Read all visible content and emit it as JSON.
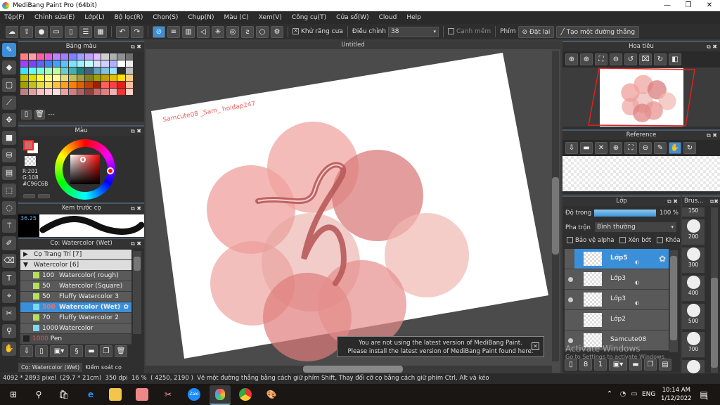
{
  "window": {
    "title": "MediBang Paint Pro (64bit)",
    "minimize": "—",
    "maximize": "❐",
    "close": "✕"
  },
  "menu": [
    "Tệp(F)",
    "Chỉnh sửa(E)",
    "Lớp(L)",
    "Bộ lọc(R)",
    "Chọn(S)",
    "Chụp(N)",
    "Màu (C)",
    "Xem(V)",
    "Công cụ(T)",
    "Cửa sổ(W)",
    "Cloud",
    "Help"
  ],
  "toolbar": {
    "antialias_label": "Khử răng cưa",
    "antialias_checked": true,
    "adjust_label": "Điều chỉnh",
    "adjust_value": "38",
    "soft_edge_label": "Cạnh mềm",
    "soft_edge_checked": false,
    "key_label": "Phím",
    "reset_label": "Đặt lại",
    "line_label": "Tạo một đường thẳng"
  },
  "palette": {
    "title": "Bảng màu",
    "footer_text": "---",
    "rows": [
      [
        "#ff8080",
        "#ffa0a0",
        "#ff60a0",
        "#e060e0",
        "#c080ff",
        "#a080ff",
        "#8080ff",
        "#a0a0ff",
        "#c0a0ff",
        "#e0c0ff",
        "#d0d0d0",
        "#b0b0b0",
        "#909090",
        "#707070"
      ],
      [
        "#a040ff",
        "#8040ff",
        "#6060ff",
        "#4080ff",
        "#40a0ff",
        "#60c0ff",
        "#80e0ff",
        "#a0f0ff",
        "#c0ffff",
        "#e0e0ff",
        "#d0d0ff",
        "#b0b0ff",
        "#fff",
        "#eee"
      ],
      [
        "#40e0ff",
        "#60ffff",
        "#80ffe0",
        "#a0ffc0",
        "#c0ffa0",
        "#60d0d0",
        "#40b0b0",
        "#208080",
        "#406080",
        "#60a0c0",
        "#80c0e0",
        "#a0e0ff",
        "#303030",
        "#c0c0c0"
      ],
      [
        "#c0c000",
        "#e0e000",
        "#ffff40",
        "#ffff80",
        "#ffffa0",
        "#e0e080",
        "#c0c060",
        "#a0a040",
        "#808020",
        "#a0a000",
        "#c0a000",
        "#e0c000",
        "#ffe000",
        "#ffd080"
      ],
      [
        "#a0a000",
        "#c0c020",
        "#e0e040",
        "#ffe060",
        "#ffc040",
        "#ffa020",
        "#ff8000",
        "#e06000",
        "#c04000",
        "#a02000",
        "#ff6060",
        "#ff4040",
        "#e02020",
        "#ffc0a0"
      ],
      [
        "#c08080",
        "#e0a0a0",
        "#ffc0c0",
        "#ffd0d0",
        "#ffe0e0",
        "#f0a0a0",
        "#d08080",
        "#b06060",
        "#904040",
        "#c96c6b",
        "#e08080",
        "#f0b0b0",
        "#ff3030",
        "#ffd0c0"
      ]
    ]
  },
  "color": {
    "title": "Màu",
    "r": "R:201",
    "g": "G:108",
    "hex": "#C96C6B",
    "main": "#C96C6B"
  },
  "brush_preview": {
    "title": "Xem trước cọ",
    "size": "36.25"
  },
  "brush_panel": {
    "title": "Cọ: Watercolor (Wet)",
    "groups": [
      {
        "label": "Cọ Trang Trí [7]",
        "expanded": false
      },
      {
        "label": "Watercolor [6]",
        "expanded": true
      }
    ],
    "items": [
      {
        "size": "100",
        "name": "Watercolor( rough)",
        "color": "#b6e05a"
      },
      {
        "size": "50",
        "name": "Watercolor (Square)",
        "color": "#b6e05a"
      },
      {
        "size": "50",
        "name": "Fluffy Watercolor 3",
        "color": "#b6e05a"
      },
      {
        "size": "500",
        "name": "Watercolor (Wet)",
        "color": "#7fd6f5",
        "selected": true
      },
      {
        "size": "70",
        "name": "Fluffy Watercolor 2",
        "color": "#b6e05a"
      },
      {
        "size": "1000",
        "name": "Watercolor",
        "color": "#7fd6f5"
      }
    ],
    "pen": {
      "size": "1000",
      "name": "Pen"
    },
    "tabs": [
      "Cọ: Watercolor (Wet)",
      "Kiểm soát cọ"
    ]
  },
  "canvas": {
    "tab": "Untitled",
    "signature": "Samcute08 _Sam_ hoidap247"
  },
  "notification": {
    "line1": "You are not using the latest version of MediBang Paint.",
    "line2": "Please install the latest version of MediBang Paint found here.",
    "close": "✕"
  },
  "navigator": {
    "title": "Hoa tiêu"
  },
  "reference": {
    "title": "Reference"
  },
  "layers": {
    "title": "Lớp",
    "opacity_label": "Độ trong",
    "opacity_value": "100 %",
    "opacity": 100,
    "blend_label": "Pha trộn",
    "blend_value": "Bình thường",
    "protect_alpha": "Bảo vệ alpha",
    "clip": "Xén bớt",
    "lock": "Khóa",
    "items": [
      {
        "name": "Lớp5",
        "selected": true,
        "visible": false
      },
      {
        "name": "Lớp3",
        "visible": true
      },
      {
        "name": "Lớp3",
        "visible": true
      },
      {
        "name": "Lớp2",
        "visible": false
      },
      {
        "name": "Samcute08",
        "visible": true
      }
    ]
  },
  "brush_sizes": {
    "title": "Brus...",
    "values": [
      "150",
      "200",
      "300",
      "400",
      "500",
      "700",
      "1000"
    ]
  },
  "watermark": {
    "line1": "Activate Windows",
    "line2": "Go to Settings to activate Windows."
  },
  "status": {
    "dimensions": "4092 * 2893 pixel",
    "size_cm": "(29.7 * 21cm)",
    "dpi": "350 dpi",
    "zoom": "16 %",
    "coords": "( 4250, 2190 )",
    "hint": "Vẽ một đường thẳng bằng cách giữ phím Shift, Thay đổi cỡ cọ bằng cách giữ phím Ctrl, Alt và kéo"
  },
  "taskbar": {
    "time": "10:14 AM",
    "date": "1/12/2022",
    "lang": "ENG",
    "notifications": "1"
  }
}
